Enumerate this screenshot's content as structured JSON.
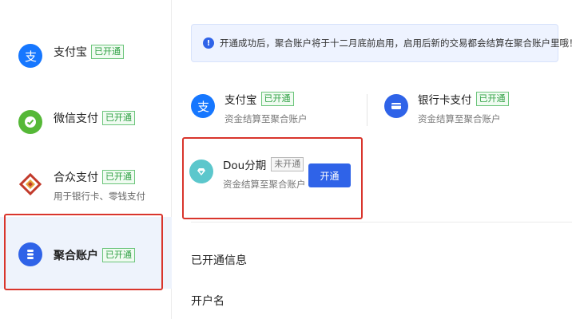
{
  "sidebar": {
    "items": [
      {
        "label": "支付宝",
        "status": "已开通",
        "icon": "alipay-icon"
      },
      {
        "label": "微信支付",
        "status": "已开通",
        "icon": "wechat-pay-icon"
      },
      {
        "label": "合众支付",
        "status": "已开通",
        "sub": "用于银行卡、零钱支付",
        "icon": "hezhong-pay-icon"
      },
      {
        "label": "聚合账户",
        "status": "已开通",
        "icon": "aggregate-account-icon"
      }
    ]
  },
  "notice": {
    "text": "开通成功后，聚合账户将于十二月底前启用，启用后新的交易都会结算在聚合账户里哦！",
    "icon": "info-icon"
  },
  "methods": [
    {
      "label": "支付宝",
      "status": "已开通",
      "desc": "资金结算至聚合账户",
      "icon": "alipay-icon"
    },
    {
      "label": "银行卡支付",
      "status": "已开通",
      "desc": "资金结算至聚合账户",
      "icon": "bank-card-icon"
    },
    {
      "label": "Dou分期",
      "status": "未开通",
      "desc": "资金结算至聚合账户",
      "icon": "dou-installment-icon",
      "button": "开通"
    }
  ],
  "info": {
    "title": "已开通信息",
    "account_name_label": "开户名"
  },
  "colors": {
    "accent": "#2f63e8",
    "highlight_border": "#d9352c",
    "tag_green": "#2ea043"
  }
}
